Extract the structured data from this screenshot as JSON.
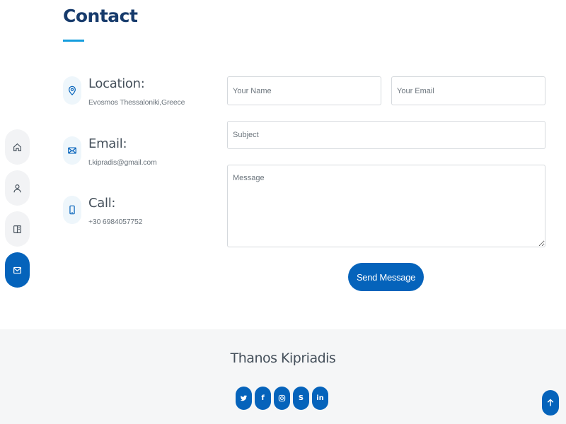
{
  "section": {
    "title": "Contact"
  },
  "nav": [
    {
      "icon": "home-icon"
    },
    {
      "icon": "person-icon"
    },
    {
      "icon": "file-icon"
    },
    {
      "icon": "envelope-icon",
      "active": true
    }
  ],
  "info": {
    "location": {
      "heading": "Location:",
      "text": "Evosmos Thessaloniki,Greece",
      "icon": "map-pin-icon"
    },
    "email": {
      "heading": "Email:",
      "text": "t.kipradis@gmail.com",
      "icon": "envelope-icon"
    },
    "call": {
      "heading": "Call:",
      "text": "+30 6984057752",
      "icon": "phone-icon"
    }
  },
  "form": {
    "name_placeholder": "Your Name",
    "email_placeholder": "Your Email",
    "subject_placeholder": "Subject",
    "message_placeholder": "Message",
    "send_label": "Send Message"
  },
  "footer": {
    "name": "Thanos Kipriadis",
    "social": [
      {
        "icon": "twitter-icon"
      },
      {
        "icon": "facebook-icon",
        "glyph": "f"
      },
      {
        "icon": "instagram-icon"
      },
      {
        "icon": "skype-icon",
        "glyph": "S"
      },
      {
        "icon": "linkedin-icon",
        "glyph": "in"
      }
    ]
  },
  "colors": {
    "accent": "#0563bb",
    "title": "#173b6c",
    "underline": "#149ddd"
  }
}
